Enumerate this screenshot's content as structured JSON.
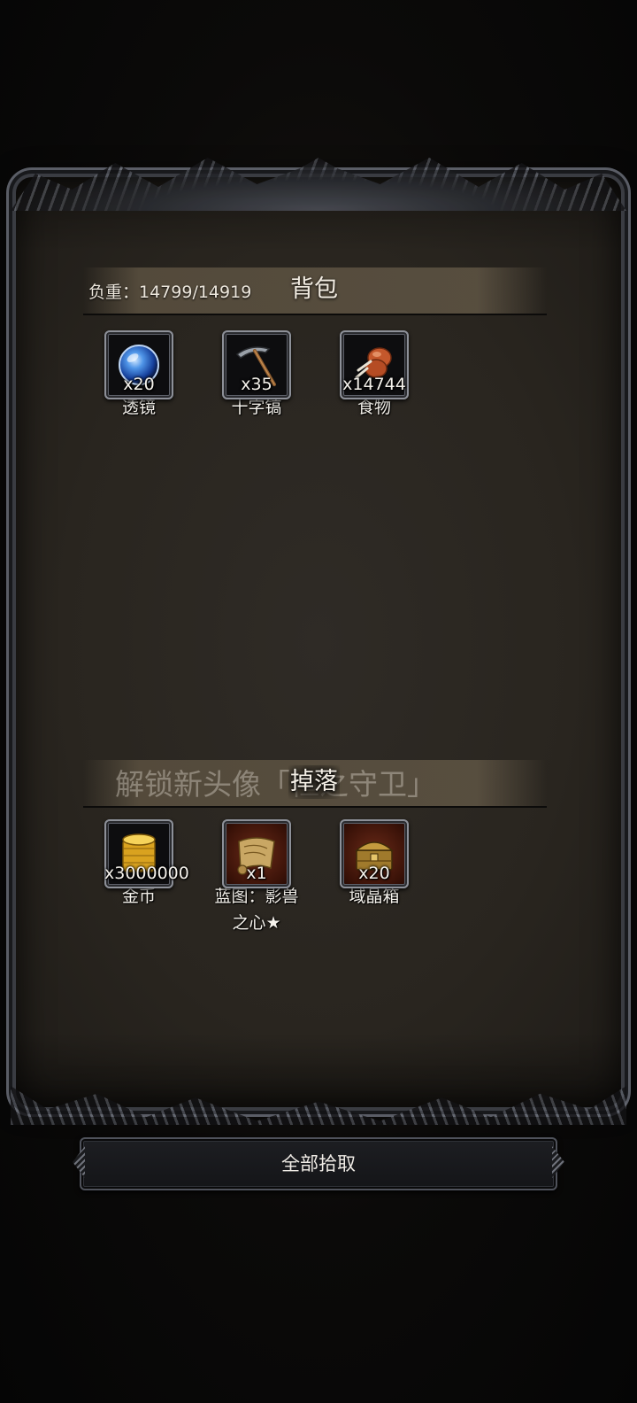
{
  "backpack": {
    "weight_label": "负重：14799/14919",
    "title": "背包",
    "items": [
      {
        "icon": "lens-icon",
        "count": "x20",
        "name": "透镜"
      },
      {
        "icon": "pickaxe-icon",
        "count": "x35",
        "name": "十字镐"
      },
      {
        "icon": "food-icon",
        "count": "x14744",
        "name": "食物"
      }
    ]
  },
  "drops": {
    "unlock_text": "解锁新头像「恒之守卫」",
    "title": "掉落",
    "items": [
      {
        "icon": "gold-coins-icon",
        "count": "x3000000",
        "name": "金币",
        "name2": ""
      },
      {
        "icon": "blueprint-scroll-icon",
        "count": "x1",
        "name": "蓝图：影兽",
        "name2": "之心★"
      },
      {
        "icon": "crystal-chest-icon",
        "count": "x20",
        "name": "域晶箱",
        "name2": ""
      }
    ]
  },
  "actions": {
    "pick_all_label": "全部拾取"
  },
  "colors": {
    "panel": "#2b2722",
    "band": "#5c5242",
    "rare_slot": "#6a2a18"
  }
}
